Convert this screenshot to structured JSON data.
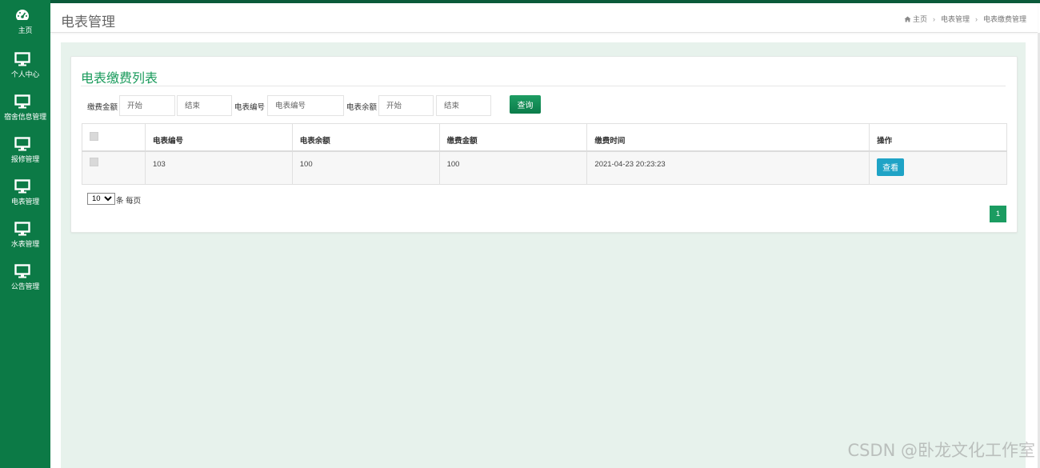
{
  "sidebar": {
    "items": [
      {
        "label": "主页",
        "icon": "dashboard-icon"
      },
      {
        "label": "个人中心",
        "icon": "monitor-icon"
      },
      {
        "label": "宿舍信息管理",
        "icon": "monitor-icon"
      },
      {
        "label": "报修管理",
        "icon": "monitor-icon"
      },
      {
        "label": "电表管理",
        "icon": "monitor-icon"
      },
      {
        "label": "水表管理",
        "icon": "monitor-icon"
      },
      {
        "label": "公告管理",
        "icon": "monitor-icon"
      }
    ]
  },
  "header": {
    "title": "电表管理",
    "breadcrumb": [
      "主页",
      "电表管理",
      "电表缴费管理"
    ]
  },
  "card": {
    "title": "电表缴费列表"
  },
  "search": {
    "amount_label": "缴费金额",
    "amount_start_placeholder": "开始",
    "amount_end_placeholder": "结束",
    "meter_no_label": "电表编号",
    "meter_no_placeholder": "电表编号",
    "balance_label": "电表余额",
    "balance_start_placeholder": "开始",
    "balance_end_placeholder": "结束",
    "query_label": "查询"
  },
  "table": {
    "columns": [
      "电表编号",
      "电表余额",
      "缴费金额",
      "缴费时间",
      "操作"
    ],
    "rows": [
      {
        "meter_no": "103",
        "balance": "100",
        "amount": "100",
        "time": "2021-04-23 20:23:23",
        "action": "查看"
      }
    ]
  },
  "pagination": {
    "page_size": "10",
    "page_size_suffix": "条 每页",
    "current_page": "1"
  },
  "watermark": "CSDN @卧龙文化工作室",
  "colors": {
    "sidebar": "#0c7a46",
    "accent": "#1a9b5c",
    "content_bg": "#e7f2ec",
    "view_button": "#1fa3c6"
  }
}
